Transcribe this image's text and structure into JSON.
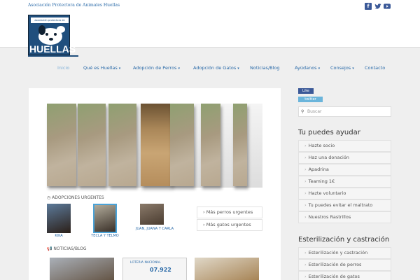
{
  "topbar": {
    "association": "Asociación Protectora de Animales Huellas",
    "social": [
      "facebook-icon",
      "twitter-icon",
      "youtube-icon"
    ]
  },
  "logo": {
    "header_text": "asociación protectora de animales",
    "word": "HUELLAS"
  },
  "nav": {
    "items": [
      {
        "label": "Inicio",
        "caret": false
      },
      {
        "label": "Qué es Huellas",
        "caret": true
      },
      {
        "label": "Adopción de Perros",
        "caret": true
      },
      {
        "label": "Adopción de Gatos",
        "caret": true
      },
      {
        "label": "Noticias/Blog",
        "caret": false
      },
      {
        "label": "Ayúdanos",
        "caret": true
      },
      {
        "label": "Consejos",
        "caret": true
      },
      {
        "label": "Contacto",
        "caret": false
      }
    ]
  },
  "main": {
    "urgent_title": "ADOPCIONES URGENTES",
    "thumbs": [
      {
        "caption": "KIKA"
      },
      {
        "caption": "TECLA Y TELMO"
      },
      {
        "caption": "JUAN, JUANA Y CARLA"
      }
    ],
    "links": [
      "Más perros urgentes",
      "Más gatos urgentes"
    ],
    "blog_title": "NOTICIAS/BLOG",
    "blog_lottery": "LOTERIA NACIONAL",
    "blog_number": "07.922"
  },
  "sidebar": {
    "fb_label": "Like",
    "tw_label": "twitter",
    "search_placeholder": "Buscar",
    "help_title": "Tu puedes ayudar",
    "help_items": [
      "Hazte socio",
      "Haz una donación",
      "Apadrina",
      "Teaming 1€",
      "Hazte voluntario",
      "Tu puedes evitar el maltrato",
      "Nuestros Rastrillos"
    ],
    "steril_title": "Esterilización y castración",
    "steril_items": [
      "Esterilización y castración",
      "Esterilización de perros",
      "Esterilización de gatos"
    ]
  },
  "colors": {
    "link_blue": "#2a6aa8",
    "active_nav": "#7fb0d8",
    "facebook": "#3b5998"
  }
}
